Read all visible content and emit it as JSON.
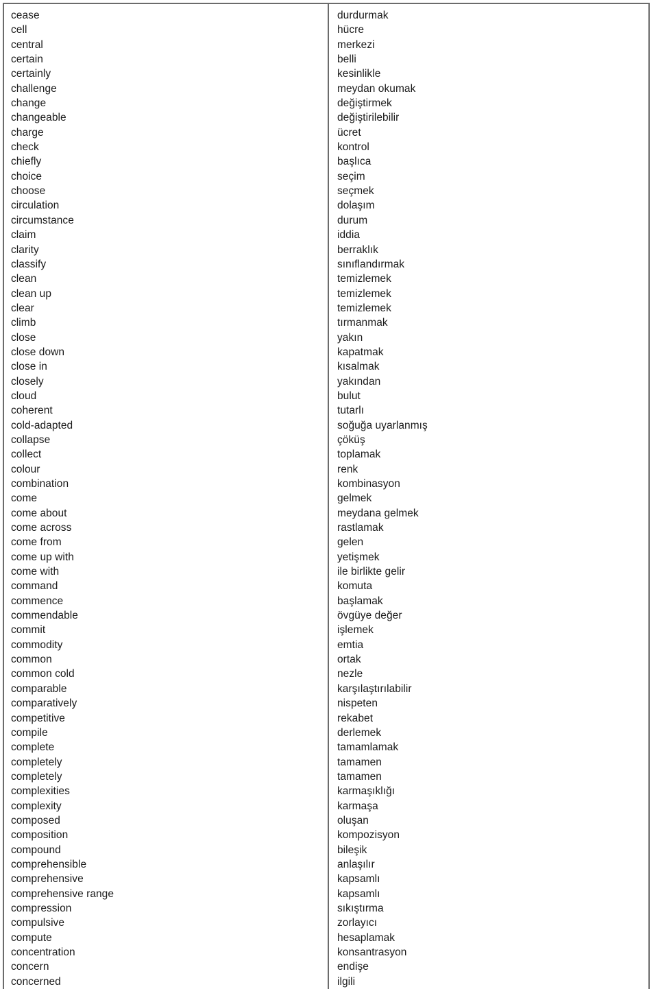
{
  "document": {
    "type": "bilingual-glossary",
    "source_language": "English",
    "target_language": "Turkish",
    "border_color": "#6b6b6b",
    "text_color": "#1a1a1a",
    "background_color": "#ffffff"
  },
  "entries": [
    {
      "source": "cease",
      "target": "durdurmak"
    },
    {
      "source": "cell",
      "target": "hücre"
    },
    {
      "source": "central",
      "target": "merkezi"
    },
    {
      "source": "certain",
      "target": "belli"
    },
    {
      "source": "certainly",
      "target": "kesinlikle"
    },
    {
      "source": "challenge",
      "target": "meydan okumak"
    },
    {
      "source": "change",
      "target": "değiştirmek"
    },
    {
      "source": "changeable",
      "target": "değiştirilebilir"
    },
    {
      "source": "charge",
      "target": "ücret"
    },
    {
      "source": "check",
      "target": "kontrol"
    },
    {
      "source": "chiefly",
      "target": "başlıca"
    },
    {
      "source": "choice",
      "target": "seçim"
    },
    {
      "source": "choose",
      "target": "seçmek"
    },
    {
      "source": "circulation",
      "target": "dolaşım"
    },
    {
      "source": "circumstance",
      "target": "durum"
    },
    {
      "source": "claim",
      "target": "iddia"
    },
    {
      "source": "clarity",
      "target": "berraklık"
    },
    {
      "source": "classify",
      "target": "sınıflandırmak"
    },
    {
      "source": "clean",
      "target": "temizlemek"
    },
    {
      "source": "clean up",
      "target": "temizlemek"
    },
    {
      "source": "clear",
      "target": "temizlemek"
    },
    {
      "source": "climb",
      "target": "tırmanmak"
    },
    {
      "source": "close",
      "target": "yakın"
    },
    {
      "source": "close down",
      "target": "kapatmak"
    },
    {
      "source": "close in",
      "target": "kısalmak"
    },
    {
      "source": "closely",
      "target": "yakından"
    },
    {
      "source": "cloud",
      "target": "bulut"
    },
    {
      "source": "coherent",
      "target": "tutarlı"
    },
    {
      "source": "cold-adapted",
      "target": "soğuğa uyarlanmış"
    },
    {
      "source": "collapse",
      "target": "çöküş"
    },
    {
      "source": "collect",
      "target": "toplamak"
    },
    {
      "source": "colour",
      "target": "renk"
    },
    {
      "source": "combination",
      "target": "kombinasyon"
    },
    {
      "source": "come",
      "target": "gelmek"
    },
    {
      "source": "come about",
      "target": "meydana gelmek"
    },
    {
      "source": "come across",
      "target": "rastlamak"
    },
    {
      "source": "come from",
      "target": "gelen"
    },
    {
      "source": "come up with",
      "target": "yetişmek"
    },
    {
      "source": "come with",
      "target": "ile birlikte gelir"
    },
    {
      "source": "command",
      "target": "komuta"
    },
    {
      "source": "commence",
      "target": "başlamak"
    },
    {
      "source": "commendable",
      "target": "övgüye değer"
    },
    {
      "source": "commit",
      "target": "işlemek"
    },
    {
      "source": "commodity",
      "target": "emtia"
    },
    {
      "source": "common",
      "target": "ortak"
    },
    {
      "source": "common cold",
      "target": "nezle"
    },
    {
      "source": "comparable",
      "target": "karşılaştırılabilir"
    },
    {
      "source": "comparatively",
      "target": "nispeten"
    },
    {
      "source": "competitive",
      "target": "rekabet"
    },
    {
      "source": "compile",
      "target": "derlemek"
    },
    {
      "source": "complete",
      "target": "tamamlamak"
    },
    {
      "source": "completely",
      "target": "tamamen"
    },
    {
      "source": "completely",
      "target": "tamamen"
    },
    {
      "source": "complexities",
      "target": "karmaşıklığı"
    },
    {
      "source": "complexity",
      "target": "karmaşa"
    },
    {
      "source": "composed",
      "target": "oluşan"
    },
    {
      "source": "composition",
      "target": "kompozisyon"
    },
    {
      "source": "compound",
      "target": "bileşik"
    },
    {
      "source": "comprehensible",
      "target": "anlaşılır"
    },
    {
      "source": "comprehensive",
      "target": "kapsamlı"
    },
    {
      "source": "comprehensive range",
      "target": "kapsamlı"
    },
    {
      "source": "compression",
      "target": "sıkıştırma"
    },
    {
      "source": "compulsive",
      "target": "zorlayıcı"
    },
    {
      "source": "compute",
      "target": "hesaplamak"
    },
    {
      "source": "concentration",
      "target": "konsantrasyon"
    },
    {
      "source": "concern",
      "target": "endişe"
    },
    {
      "source": "concerned",
      "target": "ilgili"
    }
  ]
}
